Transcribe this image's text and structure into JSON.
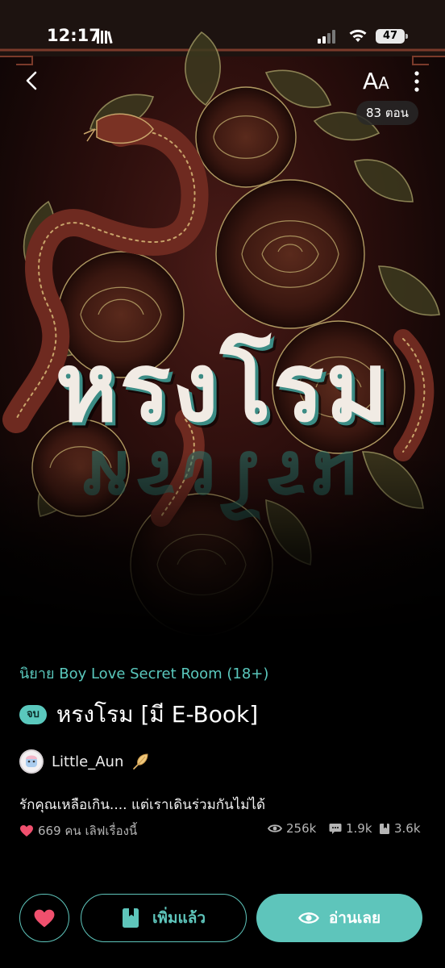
{
  "status_bar": {
    "time": "12:17",
    "battery": "47",
    "icons": [
      "library-icon",
      "signal-icon",
      "wifi-icon",
      "battery-icon"
    ]
  },
  "header": {
    "back_icon": "chevron-left-icon",
    "font_size_label_big": "A",
    "font_size_label_small": "A",
    "more_icon": "more-vertical-icon",
    "episode_count": "83 ตอน"
  },
  "cover": {
    "title_text": "หรงโรม"
  },
  "book": {
    "category": "นิยาย Boy Love Secret Room (18+)",
    "status_badge": "จบ",
    "title": "หรงโรม [มี E-Book]",
    "author": "Little_Aun",
    "author_badge_icon": "feather-icon",
    "synopsis": "รักคุณเหลือเกิน.... แต่เราเดินร่วมกันไม่ได้",
    "love_text": "669 คน เลิฟเรื่องนี้",
    "views": "256k",
    "comments": "1.9k",
    "bookmarks": "3.6k"
  },
  "actions": {
    "favorite_icon": "heart-icon",
    "added_label": "เพิ่มแล้ว",
    "read_label": "อ่านเลย"
  },
  "colors": {
    "accent": "#5ec5bb",
    "heart": "#f0506e",
    "background": "#000000"
  }
}
